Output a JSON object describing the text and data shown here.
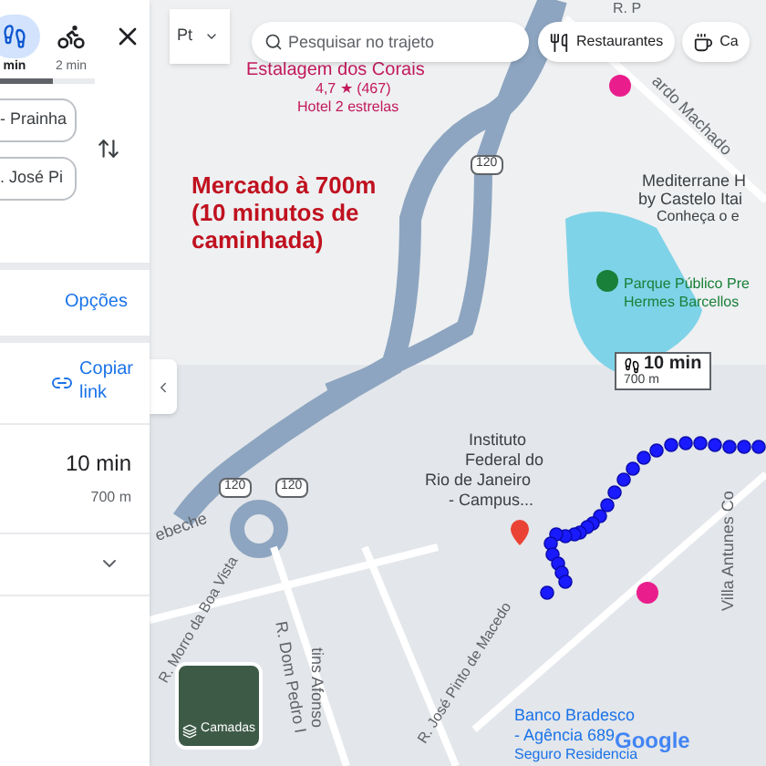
{
  "panel": {
    "modes": [
      {
        "kind": "walk",
        "time": "min",
        "selected": true
      },
      {
        "kind": "bike",
        "time": "2 min",
        "selected": false
      }
    ],
    "progress": {
      "level": 0.55
    },
    "origin": "- Prainha",
    "destination": ". José Pi",
    "options_link": "Opções",
    "copy_link": [
      "Copiar",
      "link"
    ],
    "route": {
      "time": "10 min",
      "distance": "700 m"
    }
  },
  "map": {
    "layer_button": "Pt",
    "search": {
      "placeholder": "Pesquisar no trajeto"
    },
    "chips": [
      {
        "kind": "food",
        "label": "Restaurantes"
      },
      {
        "kind": "cafe",
        "label": "Ca"
      }
    ],
    "annotation": [
      "Mercado à 700m",
      "(10 minutos de",
      "caminhada)"
    ],
    "labels": [
      {
        "kind": "hotel",
        "text": "Estalagem dos Corais"
      },
      {
        "kind": "hotel",
        "text": "4,7 ★ (467)"
      },
      {
        "kind": "hotel",
        "text": "Hotel 2 estrelas"
      },
      {
        "kind": "road",
        "text": "R. P"
      },
      {
        "kind": "road",
        "text": "ardo Machado"
      },
      {
        "kind": "place",
        "text": "Mediterrane H"
      },
      {
        "kind": "place",
        "text": "by Castelo Itai"
      },
      {
        "kind": "place",
        "text": "Conheça o e"
      },
      {
        "kind": "park",
        "text": "Parque Público Pre"
      },
      {
        "kind": "park",
        "text": "Hermes Barcellos"
      },
      {
        "kind": "place",
        "text": "Instituto"
      },
      {
        "kind": "place",
        "text": "Federal do"
      },
      {
        "kind": "place",
        "text": "Rio de Janeiro"
      },
      {
        "kind": "place",
        "text": "- Campus..."
      },
      {
        "kind": "road",
        "text": "ebeche"
      },
      {
        "kind": "road",
        "text": "R. Morro da Boa Vista"
      },
      {
        "kind": "road",
        "text": "R. Dom Pedro I"
      },
      {
        "kind": "road",
        "text": "tins Afonso"
      },
      {
        "kind": "road",
        "text": "R. José Pinto de Macedo"
      },
      {
        "kind": "road",
        "text": "Villa Antunes Co"
      },
      {
        "kind": "bank",
        "text": "Banco Bradesco"
      },
      {
        "kind": "bank",
        "text": "- Agência 689"
      },
      {
        "kind": "bank",
        "text": "Seguro Residencia"
      }
    ],
    "shields": [
      "120",
      "120",
      "120"
    ],
    "route_bubble": {
      "time": "10 min",
      "distance": "700 m"
    },
    "layers_label": "Camadas",
    "logo": "Google"
  }
}
